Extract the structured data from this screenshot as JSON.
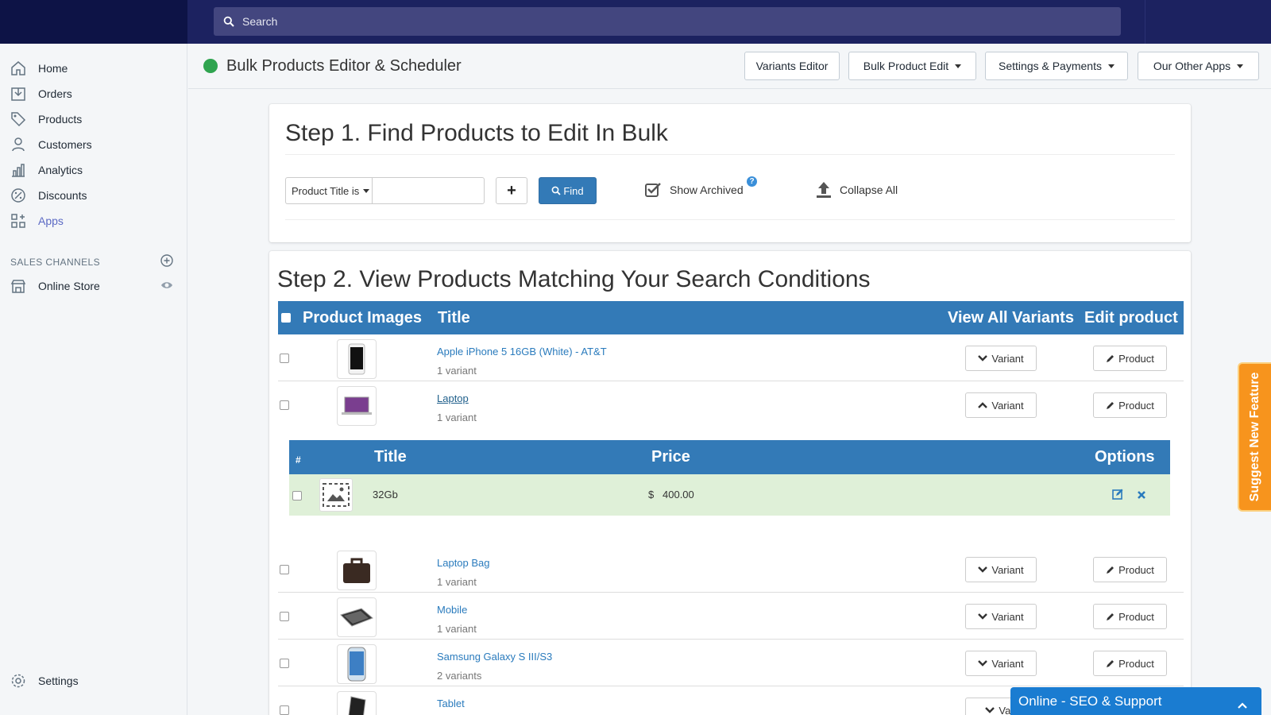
{
  "search": {
    "placeholder": "Search"
  },
  "sidebar": {
    "items": [
      {
        "label": "Home",
        "icon": "home-icon"
      },
      {
        "label": "Orders",
        "icon": "orders-icon"
      },
      {
        "label": "Products",
        "icon": "tag-icon"
      },
      {
        "label": "Customers",
        "icon": "person-icon"
      },
      {
        "label": "Analytics",
        "icon": "bar-chart-icon"
      },
      {
        "label": "Discounts",
        "icon": "discount-icon"
      },
      {
        "label": "Apps",
        "icon": "apps-icon"
      }
    ],
    "sales_channels_label": "SALES CHANNELS",
    "online_store": "Online Store",
    "settings": "Settings"
  },
  "app": {
    "title": "Bulk Products Editor & Scheduler",
    "buttons": {
      "variants_editor": "Variants Editor",
      "bulk_product_edit": "Bulk Product Edit",
      "settings_payments": "Settings & Payments",
      "other_apps": "Our Other Apps"
    }
  },
  "step1": {
    "title": "Step 1. Find Products to Edit In Bulk",
    "filter_label": "Product Title is",
    "find_label": "Find",
    "show_archived": "Show Archived",
    "help": "?",
    "collapse_all": "Collapse All"
  },
  "step2": {
    "title": "Step 2. View Products Matching Your Search Conditions",
    "headers": {
      "images": "Product Images",
      "title": "Title",
      "view_all_variants": "View All Variants",
      "edit_product": "Edit product"
    },
    "variant_button": "Variant",
    "product_button": "Product",
    "rows": [
      {
        "title": "Apple iPhone 5 16GB (White) - AT&T",
        "variants": "1 variant"
      },
      {
        "title": "Laptop",
        "variants": "1 variant"
      },
      {
        "title": "Laptop Bag",
        "variants": "1 variant"
      },
      {
        "title": "Mobile",
        "variants": "1 variant"
      },
      {
        "title": "Samsung Galaxy S III/S3",
        "variants": "2 variants"
      },
      {
        "title": "Tablet",
        "variants": ""
      }
    ],
    "variant_table": {
      "headers": {
        "num": "#",
        "title": "Title",
        "price": "Price",
        "options": "Options"
      },
      "row": {
        "title": "32Gb",
        "currency": "$",
        "price": "400.00"
      }
    },
    "tablet_variant_partial": "Vari"
  },
  "suggest_tab": "Suggest New Feature",
  "chat": {
    "label": "Online - SEO & Support"
  },
  "colors": {
    "topbar": "#1c2260",
    "primary": "#337ab7",
    "accent": "#5c6ac4",
    "suggest": "#f7941d",
    "chat": "#1a7cd1"
  }
}
